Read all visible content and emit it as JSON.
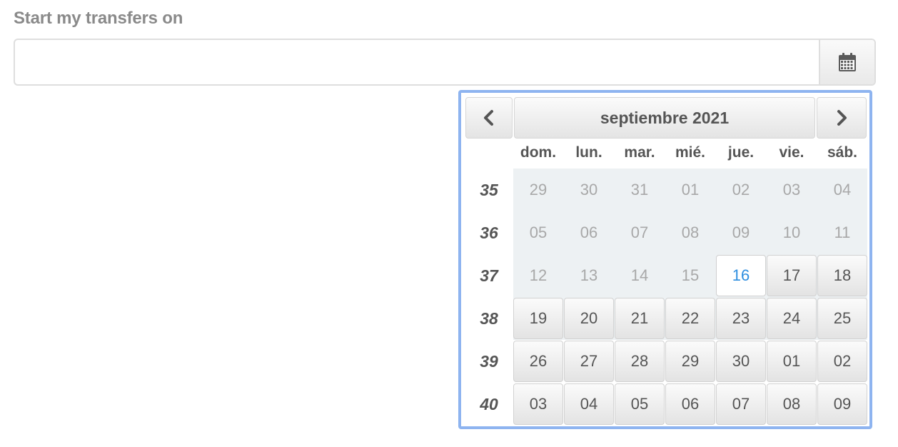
{
  "form": {
    "label": "Start my transfers on",
    "input_value": "",
    "input_placeholder": ""
  },
  "picker": {
    "month_label": "septiembre 2021",
    "weekdays": [
      "dom.",
      "lun.",
      "mar.",
      "mié.",
      "jue.",
      "vie.",
      "sáb."
    ],
    "weeks": [
      {
        "number": "35",
        "days": [
          {
            "label": "29",
            "state": "disabled"
          },
          {
            "label": "30",
            "state": "disabled"
          },
          {
            "label": "31",
            "state": "disabled"
          },
          {
            "label": "01",
            "state": "disabled"
          },
          {
            "label": "02",
            "state": "disabled"
          },
          {
            "label": "03",
            "state": "disabled"
          },
          {
            "label": "04",
            "state": "disabled"
          }
        ]
      },
      {
        "number": "36",
        "days": [
          {
            "label": "05",
            "state": "disabled"
          },
          {
            "label": "06",
            "state": "disabled"
          },
          {
            "label": "07",
            "state": "disabled"
          },
          {
            "label": "08",
            "state": "disabled"
          },
          {
            "label": "09",
            "state": "disabled"
          },
          {
            "label": "10",
            "state": "disabled"
          },
          {
            "label": "11",
            "state": "disabled"
          }
        ]
      },
      {
        "number": "37",
        "days": [
          {
            "label": "12",
            "state": "disabled"
          },
          {
            "label": "13",
            "state": "disabled"
          },
          {
            "label": "14",
            "state": "disabled"
          },
          {
            "label": "15",
            "state": "disabled"
          },
          {
            "label": "16",
            "state": "today"
          },
          {
            "label": "17",
            "state": "enabled"
          },
          {
            "label": "18",
            "state": "enabled"
          }
        ]
      },
      {
        "number": "38",
        "days": [
          {
            "label": "19",
            "state": "enabled"
          },
          {
            "label": "20",
            "state": "enabled"
          },
          {
            "label": "21",
            "state": "enabled"
          },
          {
            "label": "22",
            "state": "enabled"
          },
          {
            "label": "23",
            "state": "enabled"
          },
          {
            "label": "24",
            "state": "enabled"
          },
          {
            "label": "25",
            "state": "enabled"
          }
        ]
      },
      {
        "number": "39",
        "days": [
          {
            "label": "26",
            "state": "enabled"
          },
          {
            "label": "27",
            "state": "enabled"
          },
          {
            "label": "28",
            "state": "enabled"
          },
          {
            "label": "29",
            "state": "enabled"
          },
          {
            "label": "30",
            "state": "enabled"
          },
          {
            "label": "01",
            "state": "enabled"
          },
          {
            "label": "02",
            "state": "enabled"
          }
        ]
      },
      {
        "number": "40",
        "days": [
          {
            "label": "03",
            "state": "enabled"
          },
          {
            "label": "04",
            "state": "enabled"
          },
          {
            "label": "05",
            "state": "enabled"
          },
          {
            "label": "06",
            "state": "enabled"
          },
          {
            "label": "07",
            "state": "enabled"
          },
          {
            "label": "08",
            "state": "enabled"
          },
          {
            "label": "09",
            "state": "enabled"
          }
        ]
      }
    ]
  },
  "icons": {
    "calendar": "calendar-icon",
    "prev": "chevron-left-icon",
    "next": "chevron-right-icon"
  },
  "colors": {
    "picker_border": "#8eb4f0",
    "today_text": "#2f8fe0",
    "disabled_text": "#a8a8a8",
    "disabled_bg": "#edf1f3"
  }
}
